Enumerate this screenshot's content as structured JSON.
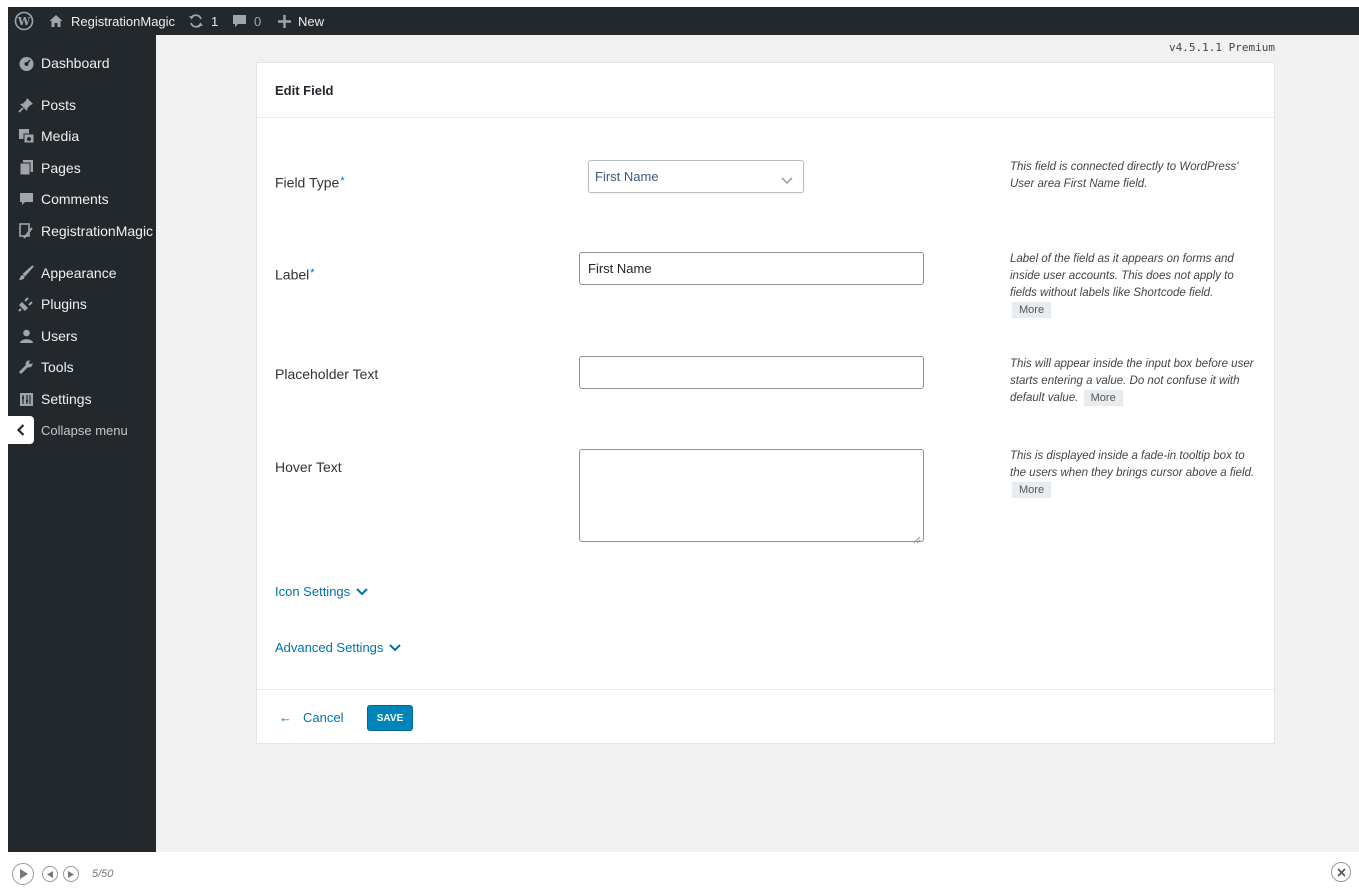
{
  "adminbar": {
    "site_name": "RegistrationMagic",
    "updates_count": "1",
    "comments_count": "0",
    "new_label": "New"
  },
  "sidebar": {
    "items": [
      {
        "label": "Dashboard",
        "icon": "dashboard-icon"
      },
      {
        "label": "Posts",
        "icon": "pin-icon"
      },
      {
        "label": "Media",
        "icon": "media-icon"
      },
      {
        "label": "Pages",
        "icon": "pages-icon"
      },
      {
        "label": "Comments",
        "icon": "comment-icon"
      },
      {
        "label": "RegistrationMagic",
        "icon": "registrationmagic-icon"
      },
      {
        "label": "Appearance",
        "icon": "brush-icon"
      },
      {
        "label": "Plugins",
        "icon": "plugin-icon"
      },
      {
        "label": "Users",
        "icon": "user-icon"
      },
      {
        "label": "Tools",
        "icon": "wrench-icon"
      },
      {
        "label": "Settings",
        "icon": "settings-icon"
      }
    ],
    "collapse_label": "Collapse menu"
  },
  "version": "v4.5.1.1 Premium",
  "form": {
    "title": "Edit Field",
    "field_type": {
      "label": "Field Type",
      "required_mark": "*",
      "value": "First Name",
      "help": "This field is connected directly to WordPress' User area First Name field."
    },
    "label": {
      "label": "Label",
      "required_mark": "*",
      "value": "First Name",
      "help": "Label of the field as it appears on forms and inside user accounts. This does not apply to fields without labels like Shortcode field.",
      "more": "More"
    },
    "placeholder": {
      "label": "Placeholder Text",
      "value": "",
      "help": "This will appear inside the input box before user starts entering a value. Do not confuse it with default value.",
      "more": "More"
    },
    "hover": {
      "label": "Hover Text",
      "value": "",
      "help": "This is displayed inside a fade-in tooltip box to the users when they brings cursor above a field.",
      "more": "More"
    },
    "icon_settings": "Icon Settings",
    "advanced_settings": "Advanced Settings",
    "cancel": "Cancel",
    "save": "SAVE"
  },
  "player": {
    "counter": "5/50"
  },
  "colors": {
    "admin_dark": "#23282d",
    "link": "#0073aa",
    "primary_button": "#0085ba"
  }
}
